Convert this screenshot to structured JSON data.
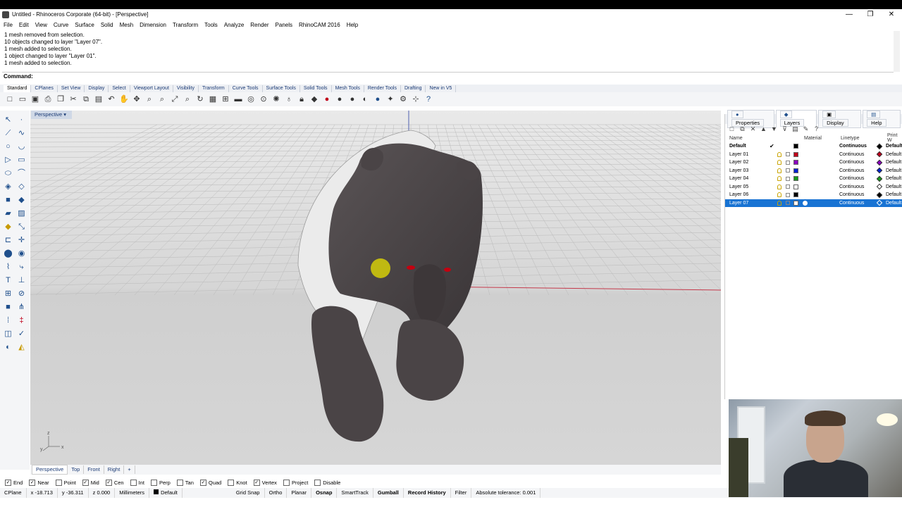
{
  "window": {
    "title": "Untitled - Rhinoceros Corporate (64-bit) - [Perspective]",
    "controls": [
      "—",
      "❐",
      "✕"
    ]
  },
  "menu": [
    "File",
    "Edit",
    "View",
    "Curve",
    "Surface",
    "Solid",
    "Mesh",
    "Dimension",
    "Transform",
    "Tools",
    "Analyze",
    "Render",
    "Panels",
    "RhinoCAM 2016",
    "Help"
  ],
  "history": [
    "1 mesh removed from selection.",
    "10 objects changed to layer \"Layer 07\".",
    "1 mesh added to selection.",
    "1 object changed to layer \"Layer 01\".",
    "1 mesh added to selection."
  ],
  "command": {
    "label": "Command:"
  },
  "toolbar_tabs": [
    "Standard",
    "CPlanes",
    "Set View",
    "Display",
    "Select",
    "Viewport Layout",
    "Visibility",
    "Transform",
    "Curve Tools",
    "Surface Tools",
    "Solid Tools",
    "Mesh Tools",
    "Render Tools",
    "Drafting",
    "New in V5"
  ],
  "viewport": {
    "label": "Perspective",
    "axis_labels": {
      "x": "x",
      "y": "y",
      "z": "z"
    }
  },
  "viewport_tabs": [
    "Perspective",
    "Top",
    "Front",
    "Right",
    "+"
  ],
  "osnaps": [
    {
      "label": "End",
      "checked": true
    },
    {
      "label": "Near",
      "checked": true
    },
    {
      "label": "Point",
      "checked": false
    },
    {
      "label": "Mid",
      "checked": true
    },
    {
      "label": "Cen",
      "checked": true
    },
    {
      "label": "Int",
      "checked": false
    },
    {
      "label": "Perp",
      "checked": false
    },
    {
      "label": "Tan",
      "checked": false
    },
    {
      "label": "Quad",
      "checked": true
    },
    {
      "label": "Knot",
      "checked": false
    },
    {
      "label": "Vertex",
      "checked": true
    },
    {
      "label": "Project",
      "checked": false
    },
    {
      "label": "Disable",
      "checked": false
    }
  ],
  "status": {
    "cplane": "CPlane",
    "x": "x -18.713",
    "y": "y -36.311",
    "z": "z 0.000",
    "units": "Millimeters",
    "layer": "Default",
    "grid_snap": "Grid Snap",
    "ortho": "Ortho",
    "planar": "Planar",
    "osnap": "Osnap",
    "smarttrack": "SmartTrack",
    "gumball": "Gumball",
    "record_history": "Record History",
    "filter": "Filter",
    "tolerance": "Absolute tolerance: 0.001"
  },
  "panel": {
    "tabs": [
      "Properties",
      "Layers",
      "Display",
      "Help"
    ],
    "active_tab": "Layers",
    "columns": {
      "name": "Name",
      "material": "Material",
      "linetype": "Linetype",
      "print_width": "Print W"
    },
    "layers": [
      {
        "name": "Default",
        "current": "✔",
        "color": "#000000",
        "linetype": "Continuous",
        "print": "Default",
        "selected": false
      },
      {
        "name": "Layer 01",
        "current": "",
        "color": "#c0001a",
        "linetype": "Continuous",
        "print": "Default",
        "selected": false
      },
      {
        "name": "Layer 02",
        "current": "",
        "color": "#8a00c0",
        "linetype": "Continuous",
        "print": "Default",
        "selected": false
      },
      {
        "name": "Layer 03",
        "current": "",
        "color": "#0020d0",
        "linetype": "Continuous",
        "print": "Default",
        "selected": false
      },
      {
        "name": "Layer 04",
        "current": "",
        "color": "#1a9a1a",
        "linetype": "Continuous",
        "print": "Default",
        "selected": false
      },
      {
        "name": "Layer 05",
        "current": "",
        "color": "#ffffff",
        "linetype": "Continuous",
        "print": "Default",
        "selected": false
      },
      {
        "name": "Layer 06",
        "current": "",
        "color": "#000000",
        "linetype": "Continuous",
        "print": "Default",
        "selected": false
      },
      {
        "name": "Layer 07",
        "current": "",
        "color": "#ffffff",
        "linetype": "Continuous",
        "print": "Default",
        "selected": true
      }
    ]
  },
  "colors": {
    "accent": "#1873d3",
    "viewport_bg": "#d6d6d6",
    "model": "#4a4446"
  }
}
